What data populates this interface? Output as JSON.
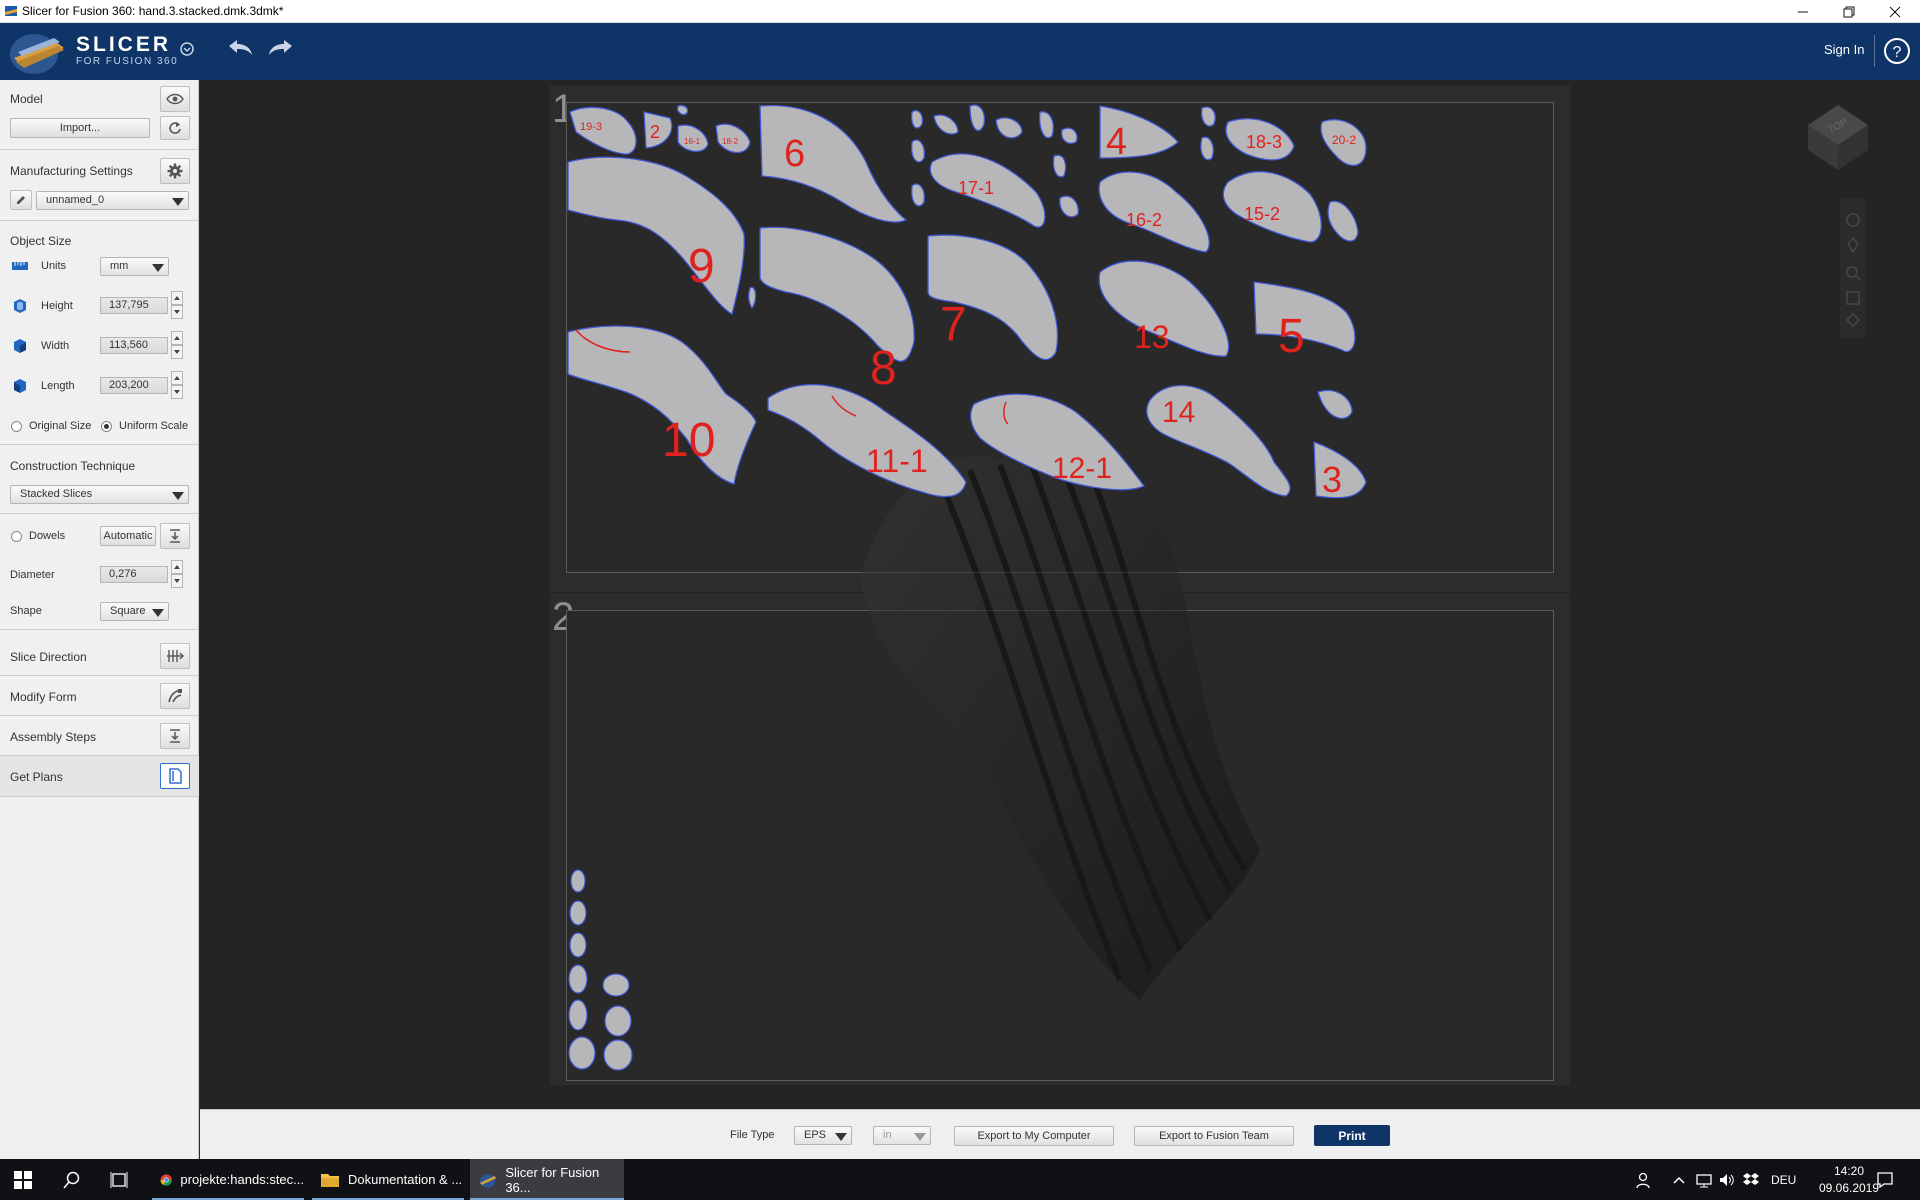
{
  "window": {
    "title": "Slicer for Fusion 360: hand.3.stacked.dmk.3dmk*"
  },
  "header": {
    "brand": "SLICER",
    "brand_sub": "FOR FUSION 360",
    "sign_in": "Sign In",
    "help_glyph": "?"
  },
  "left_panel": {
    "model": {
      "title": "Model",
      "import_label": "Import..."
    },
    "manufacturing": {
      "title": "Manufacturing Settings",
      "profile": "unnamed_0"
    },
    "object_size": {
      "title": "Object Size",
      "units_label": "Units",
      "units_value": "mm",
      "height_label": "Height",
      "height_value": "137,795",
      "width_label": "Width",
      "width_value": "113,560",
      "length_label": "Length",
      "length_value": "203,200",
      "original_size_label": "Original Size",
      "uniform_scale_label": "Uniform Scale",
      "uniform_scale_selected": true
    },
    "construction": {
      "title": "Construction Technique",
      "value": "Stacked Slices"
    },
    "dowels": {
      "label": "Dowels",
      "mode": "Automatic",
      "diameter_label": "Diameter",
      "diameter_value": "0,276",
      "shape_label": "Shape",
      "shape_value": "Square"
    },
    "sections": {
      "slice_direction": "Slice Direction",
      "modify_form": "Modify Form",
      "assembly_steps": "Assembly Steps",
      "get_plans": "Get Plans"
    }
  },
  "canvas": {
    "sheets": [
      {
        "number": "1",
        "parts": [
          {
            "label": "19-3"
          },
          {
            "label": "2"
          },
          {
            "label": "16-1"
          },
          {
            "label": "18-2"
          },
          {
            "label": "6"
          },
          {
            "label": "4"
          },
          {
            "label": "18-3"
          },
          {
            "label": "20-2"
          },
          {
            "label": "17-1"
          },
          {
            "label": "16-2"
          },
          {
            "label": "15-2"
          },
          {
            "label": "9"
          },
          {
            "label": "8"
          },
          {
            "label": "7"
          },
          {
            "label": "13"
          },
          {
            "label": "5"
          },
          {
            "label": "10"
          },
          {
            "label": "11-1"
          },
          {
            "label": "12-1"
          },
          {
            "label": "14"
          },
          {
            "label": "3"
          }
        ]
      },
      {
        "number": "2"
      }
    ],
    "view_cube_label": "TOP"
  },
  "bottom_bar": {
    "file_type_label": "File Type",
    "file_type_value": "EPS",
    "units_value": "in",
    "export_computer": "Export to My Computer",
    "export_team": "Export to Fusion Team",
    "print": "Print"
  },
  "taskbar": {
    "apps": [
      {
        "label": "projekte:hands:stec..."
      },
      {
        "label": "Dokumentation & ..."
      },
      {
        "label": "Slicer for Fusion 36..."
      }
    ],
    "language": "DEU",
    "time": "14:20",
    "date": "09.06.2019"
  },
  "colors": {
    "header_bg": "#0e3468",
    "part_fill": "#b7b7b9",
    "part_outline": "#3f57d6",
    "part_marking": "#e0221f"
  }
}
